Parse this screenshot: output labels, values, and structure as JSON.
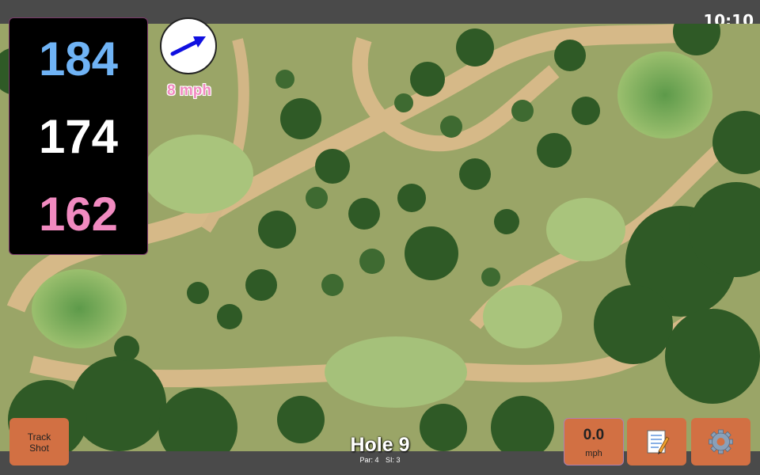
{
  "status_bar": {
    "time": "10:10"
  },
  "distances": {
    "back": "184",
    "middle": "174",
    "front": "162",
    "colors": {
      "back": "#6fb3f5",
      "middle": "#ffffff",
      "front": "#f18ac0"
    }
  },
  "wind": {
    "speed_label": "8 mph",
    "direction_icon": "arrow-icon",
    "arrow_color": "#1010e0"
  },
  "hole": {
    "title": "Hole 9",
    "par": "Par: 4",
    "stroke_index": "SI: 3"
  },
  "buttons": {
    "track_line1": "Track",
    "track_line2": "Shot",
    "speed_value": "0.0",
    "speed_unit": "mph",
    "notes_icon": "notepad-icon",
    "settings_icon": "gear-icon",
    "accent": "#d27043"
  }
}
